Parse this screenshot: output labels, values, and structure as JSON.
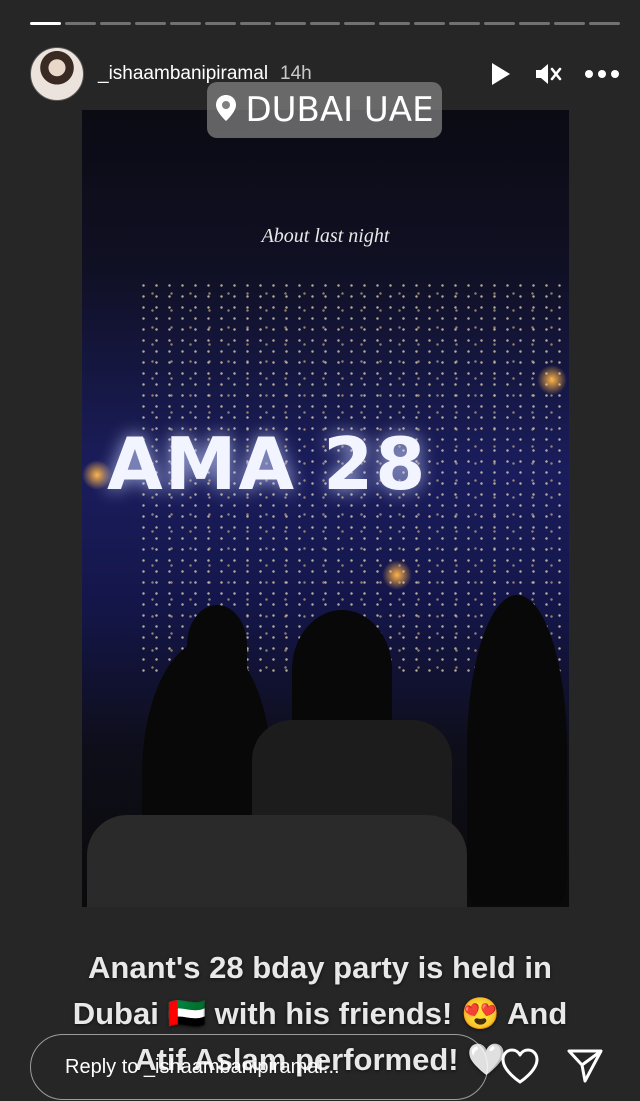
{
  "story": {
    "progress_segments": 17,
    "progress_current": 1,
    "username": "_ishaambanipiramal",
    "time_ago": "14h",
    "location_sticker": "DUBAI UAE",
    "photo_caption": "About last night",
    "stage_text": "AMA 28",
    "overlay_lines": [
      "Anant's 28 bday party is held in",
      "Dubai 🇦🇪 with his friends! 😍 And",
      "Atif Aslam performed! 🤍"
    ]
  },
  "controls": {
    "play_icon": "play-icon",
    "mute_icon": "muted-speaker-icon",
    "more_icon": "more-options-icon"
  },
  "footer": {
    "reply_placeholder": "Reply to _ishaambanipiramal...",
    "like_icon": "heart-icon",
    "share_icon": "send-icon"
  }
}
